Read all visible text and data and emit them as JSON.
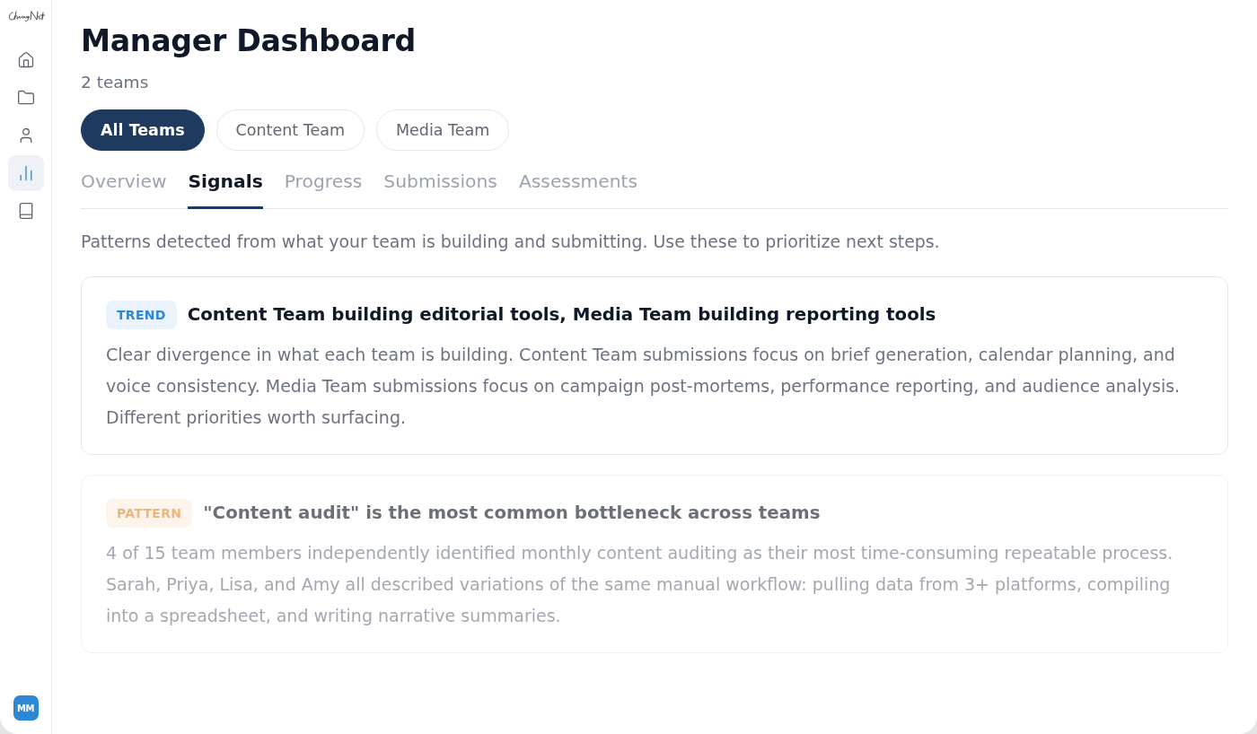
{
  "sidebar": {
    "nav_items": [
      {
        "kind": "home",
        "selected": false
      },
      {
        "kind": "folder",
        "selected": false
      },
      {
        "kind": "user",
        "selected": false
      },
      {
        "kind": "chart",
        "selected": true
      },
      {
        "kind": "book",
        "selected": false
      }
    ],
    "avatar": {
      "initials": "MM"
    }
  },
  "header": {
    "title": "Manager Dashboard",
    "subtitle": "2 teams"
  },
  "team_filters": [
    {
      "label": "All Teams",
      "selected": true
    },
    {
      "label": "Content Team",
      "selected": false
    },
    {
      "label": "Media Team",
      "selected": false
    }
  ],
  "tabs": [
    {
      "label": "Overview",
      "selected": false
    },
    {
      "label": "Signals",
      "selected": true
    },
    {
      "label": "Progress",
      "selected": false
    },
    {
      "label": "Submissions",
      "selected": false
    },
    {
      "label": "Assessments",
      "selected": false
    }
  ],
  "description": "Patterns detected from what your team is building and submitting. Use these to prioritize next steps.",
  "signals": [
    {
      "kind": "trend",
      "tag": "TREND",
      "title": "Content Team building editorial tools, Media Team building reporting tools",
      "body": "Clear divergence in what each team is building. Content Team submissions focus on brief generation, calendar planning, and voice consistency. Media Team submissions focus on campaign post-mortems, performance reporting, and audience analysis. Different priorities worth surfacing.",
      "faded": false
    },
    {
      "kind": "pattern",
      "tag": "PATTERN",
      "title": "\"Content audit\" is the most common bottleneck across teams",
      "body": "4 of 15 team members independently identified monthly content auditing as their most time-consuming repeatable process. Sarah, Priya, Lisa, and Amy all described variations of the same manual workflow: pulling data from 3+ platforms, compiling into a spreadsheet, and writing narrative summaries.",
      "faded": true
    }
  ]
}
